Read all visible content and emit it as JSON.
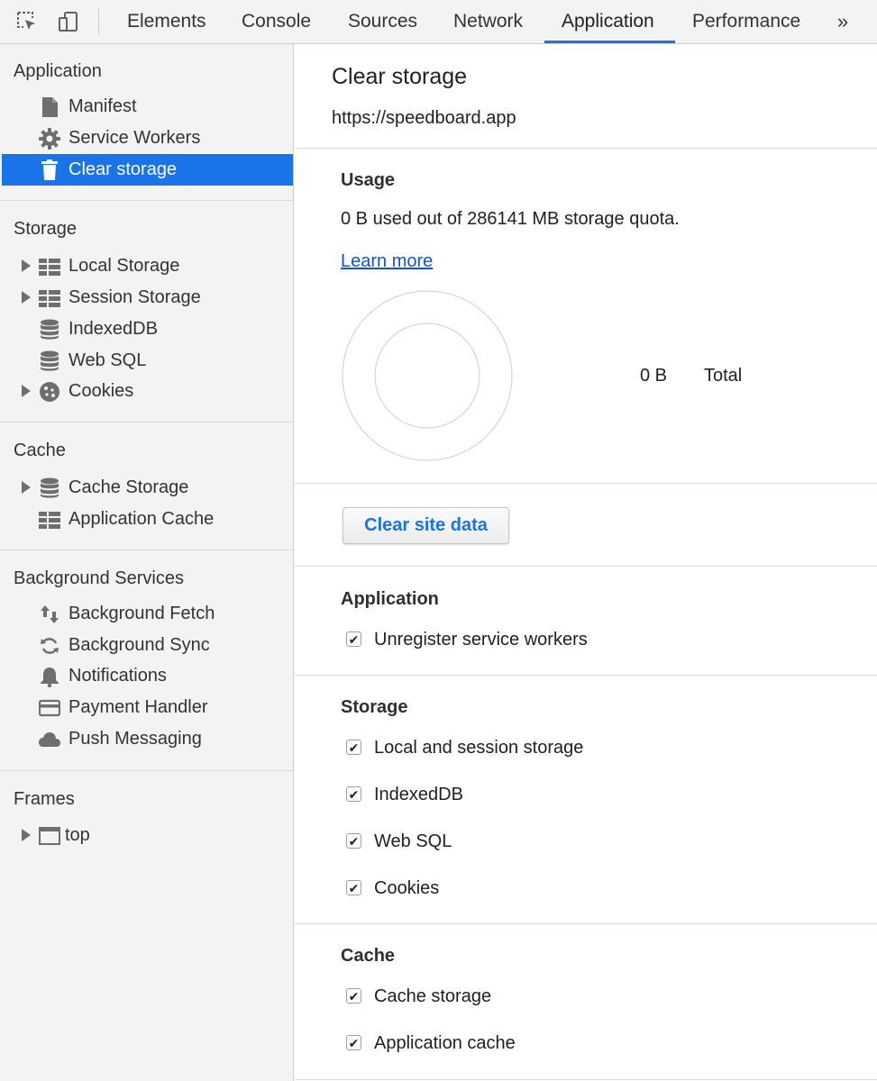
{
  "toolbar": {
    "tabs": [
      "Elements",
      "Console",
      "Sources",
      "Network",
      "Application",
      "Performance"
    ],
    "active_tab": "Application",
    "more_label": "»",
    "accent_color": "#1a73e8"
  },
  "sidebar": {
    "sections": {
      "application": {
        "title": "Application",
        "items": [
          "Manifest",
          "Service Workers",
          "Clear storage"
        ]
      },
      "storage": {
        "title": "Storage",
        "items": [
          "Local Storage",
          "Session Storage",
          "IndexedDB",
          "Web SQL",
          "Cookies"
        ]
      },
      "cache": {
        "title": "Cache",
        "items": [
          "Cache Storage",
          "Application Cache"
        ]
      },
      "background": {
        "title": "Background Services",
        "items": [
          "Background Fetch",
          "Background Sync",
          "Notifications",
          "Payment Handler",
          "Push Messaging"
        ]
      },
      "frames": {
        "title": "Frames",
        "items": [
          "top"
        ]
      }
    },
    "selected_item": "Clear storage"
  },
  "main": {
    "title": "Clear storage",
    "origin": "https://speedboard.app",
    "usage": {
      "heading": "Usage",
      "text": "0 B used out of 286141 MB storage quota.",
      "learn_more": "Learn more",
      "legend_value": "0 B",
      "legend_label": "Total"
    },
    "clear_button": "Clear site data",
    "application": {
      "heading": "Application",
      "options": [
        {
          "label": "Unregister service workers",
          "checked": true
        }
      ]
    },
    "storage": {
      "heading": "Storage",
      "options": [
        {
          "label": "Local and session storage",
          "checked": true
        },
        {
          "label": "IndexedDB",
          "checked": true
        },
        {
          "label": "Web SQL",
          "checked": true
        },
        {
          "label": "Cookies",
          "checked": true
        }
      ]
    },
    "cache": {
      "heading": "Cache",
      "options": [
        {
          "label": "Cache storage",
          "checked": true
        },
        {
          "label": "Application cache",
          "checked": true
        }
      ]
    }
  }
}
